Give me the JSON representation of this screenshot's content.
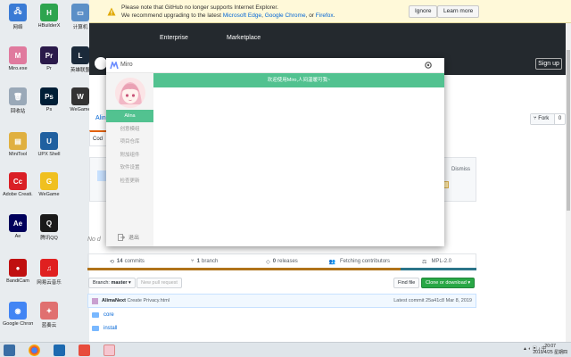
{
  "desktop": {
    "icons": [
      {
        "label": "网络",
        "glyph": "🖧",
        "color": "#3a7bd5"
      },
      {
        "label": "HBuilderX",
        "glyph": "H",
        "color": "#2ea44f"
      },
      {
        "label": "计算机",
        "glyph": "▭",
        "color": "#5b8fc7"
      },
      {
        "label": "Miro.exe",
        "glyph": "M",
        "color": "#e07a9e"
      },
      {
        "label": "Pr",
        "glyph": "Pr",
        "color": "#2a1a4a"
      },
      {
        "label": "英雄联盟",
        "glyph": "L",
        "color": "#1b2a3a"
      },
      {
        "label": "回收站",
        "glyph": "🗑",
        "color": "#9aa9b8"
      },
      {
        "label": "Ps",
        "glyph": "Ps",
        "color": "#001e36"
      },
      {
        "label": "WeGame",
        "glyph": "W",
        "color": "#333"
      },
      {
        "label": "MiniTool",
        "glyph": "▤",
        "color": "#e0b040"
      },
      {
        "label": "UPX Shell",
        "glyph": "U",
        "color": "#2060a0"
      },
      {
        "label": "Adobe Creati...",
        "glyph": "Cc",
        "color": "#da1f26"
      },
      {
        "label": "WeGame",
        "glyph": "G",
        "color": "#f0c020"
      },
      {
        "label": "Ae",
        "glyph": "Ae",
        "color": "#00005b"
      },
      {
        "label": "腾讯QQ",
        "glyph": "Q",
        "color": "#1a1a1a"
      },
      {
        "label": "BandiCam",
        "glyph": "●",
        "color": "#c01010"
      },
      {
        "label": "网易云音乐",
        "glyph": "♫",
        "color": "#e02020"
      },
      {
        "label": "Google Chrome",
        "glyph": "◉",
        "color": "#4285f4"
      },
      {
        "label": "蓝奏云",
        "glyph": "✦",
        "color": "#e07070"
      }
    ]
  },
  "ie_bar": {
    "line1": "Please note that GitHub no longer supports Internet Explorer.",
    "line2_prefix": "We recommend upgrading to the latest ",
    "link_edge": "Microsoft Edge",
    "sep1": ", ",
    "link_chrome": "Google Chrome",
    "sep2": ", or ",
    "link_firefox": "Firefox",
    "end": ".",
    "ignore_label": "Ignore",
    "learn_label": "Learn more"
  },
  "github": {
    "nav": [
      "Enterprise",
      "Marketplace"
    ],
    "signup_label": "Sign up",
    "fork_label": "Fork",
    "fork_count": "0",
    "repo_frag": "Alin",
    "code_tab": "Cod",
    "dismiss": "Dismiss",
    "no_desc": "No d",
    "stats": [
      {
        "icon": "⟲",
        "value": "14",
        "label": "commits"
      },
      {
        "icon": "⑂",
        "value": "1",
        "label": "branch"
      },
      {
        "icon": "◇",
        "value": "0",
        "label": "releases"
      },
      {
        "icon": "👥",
        "value": "",
        "label": "Fetching contributors"
      },
      {
        "icon": "⚖",
        "value": "",
        "label": "MPL-2.0"
      }
    ],
    "branch_label": "Branch: ",
    "branch_name": "master",
    "new_pr_label": "New pull request",
    "find_file_label": "Find file",
    "clone_label": "Clone or download",
    "commit_author": "AlimaNext",
    "commit_msg": "Create Privacy.html",
    "latest_commit": "Latest commit 25a41c8 Mar 8, 2019",
    "files": [
      "core",
      "install"
    ]
  },
  "miro": {
    "title": "Miro",
    "banner": "欢迎使用Miro,人间温暖可我~",
    "menu": [
      "Alina",
      "创意模组",
      "项目仓库",
      "附加组件",
      "软件设置",
      "检查更新"
    ],
    "exit_label": "退出"
  },
  "taskbar": {
    "tray_text": "▲ ◐ ▣ ♪ 中",
    "time": "20:07",
    "date": "2019/4/25 星期四"
  }
}
